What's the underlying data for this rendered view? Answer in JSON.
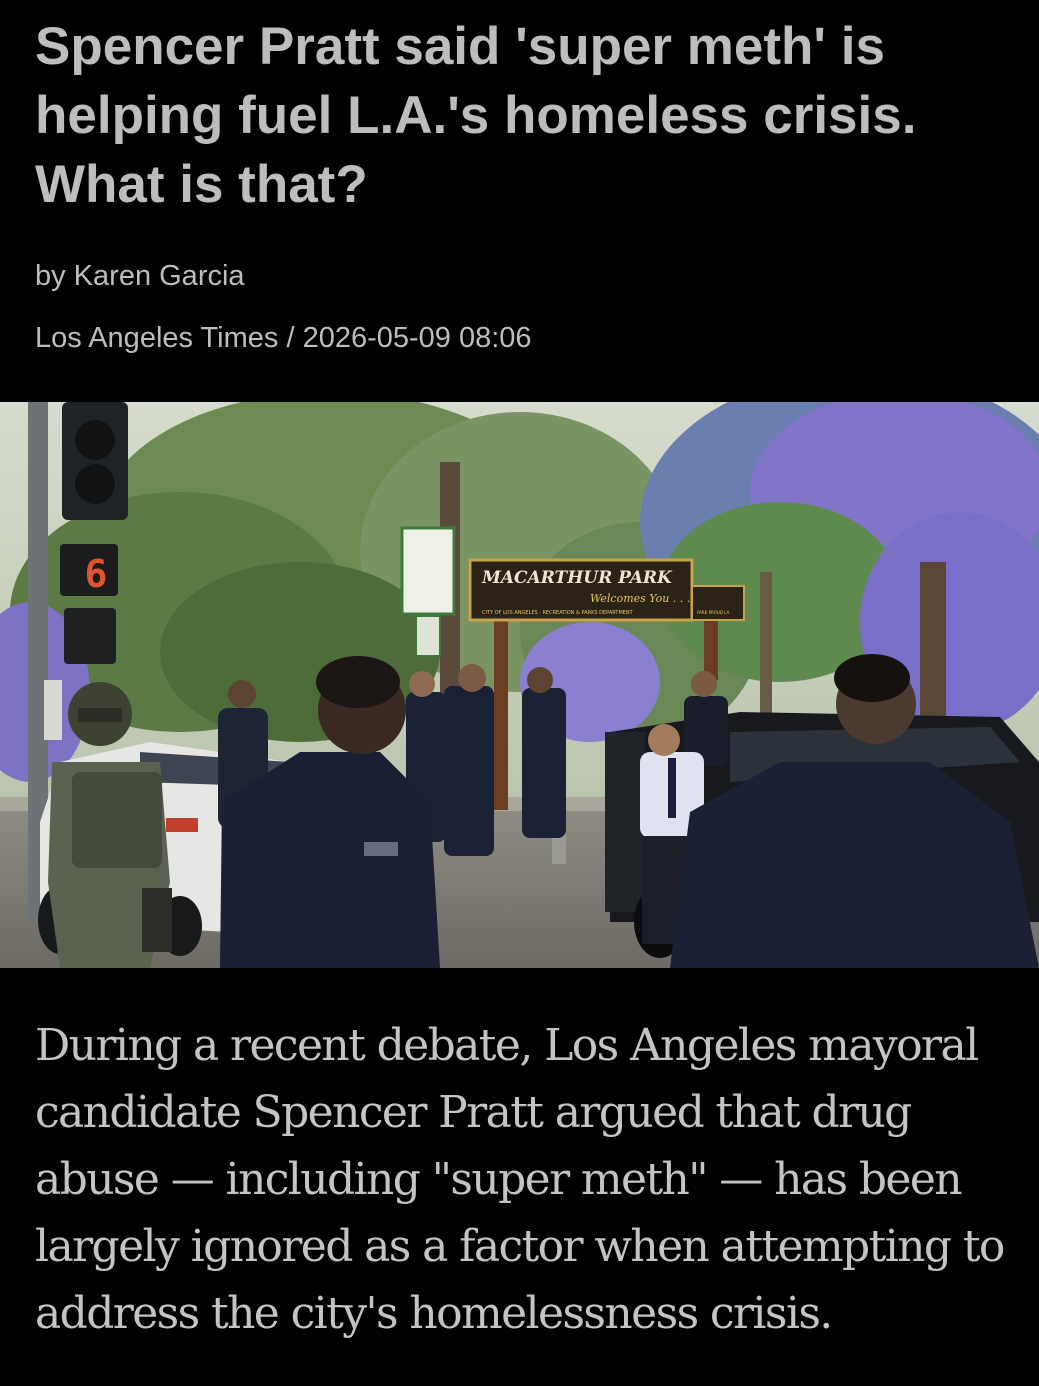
{
  "article": {
    "headline": "Spencer Pratt said 'super meth' is helping fuel L.A.'s homeless crisis. What is that?",
    "byline": "by Karen Garcia",
    "source": "Los Angeles Times",
    "separator": " / ",
    "timestamp": "2026-05-09 08:06",
    "lede": "During a recent debate, Los Angeles mayoral candidate Spencer Pratt argued that drug abuse — including \"super meth\" — has been largely ignored as a factor when attempting to address the city's homelessness crisis."
  },
  "photo": {
    "sign_title": "MACARTHUR PARK",
    "sign_welcome": "Welcomes You . . .",
    "sign_footer": "CITY OF LOS ANGELES · RECREATION & PARKS DEPARTMENT",
    "sign_tag": "PARK PROUD LA",
    "signal_digit": "6",
    "colors": {
      "background": "#000000",
      "text": "#bdbdbd",
      "sky": "#d8e0d0",
      "foliage": "#5d7a45",
      "jacaranda": "#7a6fc8",
      "uniform": "#1c2236",
      "sign_board": "#2a2418",
      "sign_text": "#e8c460"
    }
  }
}
